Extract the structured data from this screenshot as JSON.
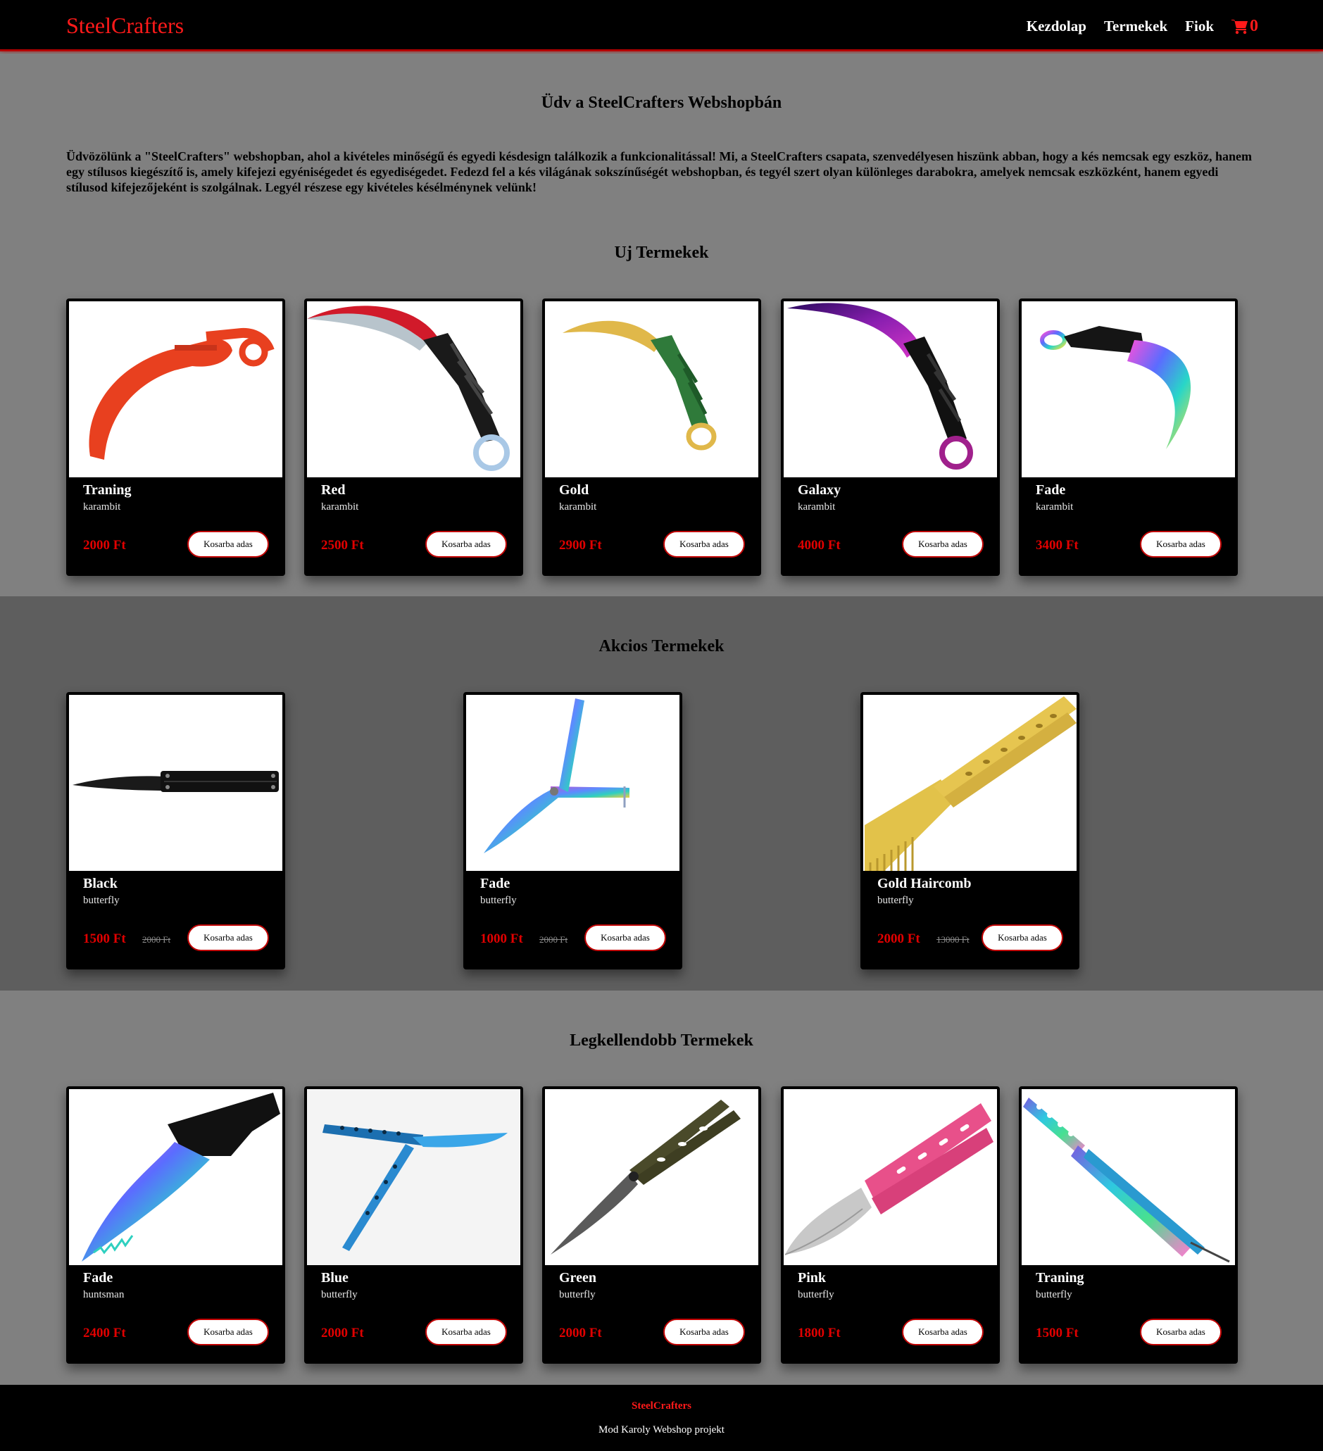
{
  "navbar": {
    "brand": "SteelCrafters",
    "links": [
      "Kezdolap",
      "Termekek",
      "Fiok"
    ],
    "cart_count": "0"
  },
  "welcome": {
    "title": "Üdv a SteelCrafters Webshopbán",
    "text": "Üdvözölünk a \"SteelCrafters\" webshopban, ahol a kivételes minőségű és egyedi késdesign találkozik a funkcionalitással! Mi, a SteelCrafters csapata, szenvedélyesen hiszünk abban, hogy a kés nemcsak egy eszköz, hanem egy stílusos kiegészítő is, amely kifejezi egyéniségedet és egyediségedet. Fedezd fel a kés világának sokszínűségét webshopban, és tegyél szert olyan különleges darabokra, amelyek nemcsak eszközként, hanem egyedi stílusod kifejezőjeként is szolgálnak. Legyél részese egy kivételes késélménynek velünk!"
  },
  "sections": [
    {
      "title": "Uj Termekek",
      "products": [
        {
          "name": "Traning",
          "type": "karambit",
          "price": "2000 Ft",
          "button": "Kosarba adas"
        },
        {
          "name": "Red",
          "type": "karambit",
          "price": "2500 Ft",
          "button": "Kosarba adas"
        },
        {
          "name": "Gold",
          "type": "karambit",
          "price": "2900 Ft",
          "button": "Kosarba adas"
        },
        {
          "name": "Galaxy",
          "type": "karambit",
          "price": "4000 Ft",
          "button": "Kosarba adas"
        },
        {
          "name": "Fade",
          "type": "karambit",
          "price": "3400 Ft",
          "button": "Kosarba adas"
        }
      ]
    },
    {
      "title": "Akcios Termekek",
      "products": [
        {
          "name": "Black",
          "type": "butterfly",
          "price": "1500 Ft",
          "old_price": "2000 Ft",
          "button": "Kosarba adas"
        },
        {
          "name": "Fade",
          "type": "butterfly",
          "price": "1000 Ft",
          "old_price": "2000 Ft",
          "button": "Kosarba adas"
        },
        {
          "name": "Gold Haircomb",
          "type": "butterfly",
          "price": "2000 Ft",
          "old_price": "13000 Ft",
          "button": "Kosarba adas"
        }
      ]
    },
    {
      "title": "Legkellendobb Termekek",
      "products": [
        {
          "name": "Fade",
          "type": "huntsman",
          "price": "2400 Ft",
          "button": "Kosarba adas"
        },
        {
          "name": "Blue",
          "type": "butterfly",
          "price": "2000 Ft",
          "button": "Kosarba adas"
        },
        {
          "name": "Green",
          "type": "butterfly",
          "price": "2000 Ft",
          "button": "Kosarba adas"
        },
        {
          "name": "Pink",
          "type": "butterfly",
          "price": "1800 Ft",
          "button": "Kosarba adas"
        },
        {
          "name": "Traning",
          "type": "butterfly",
          "price": "1500 Ft",
          "button": "Kosarba adas"
        }
      ]
    }
  ],
  "footer": {
    "brand": "SteelCrafters",
    "text": "Mod Karoly Webshop projekt"
  },
  "colors": {
    "accent": "#ff1a1a",
    "navbar": "#000000",
    "page_bg": "#808080",
    "sale_bg": "#5e5e5e"
  }
}
